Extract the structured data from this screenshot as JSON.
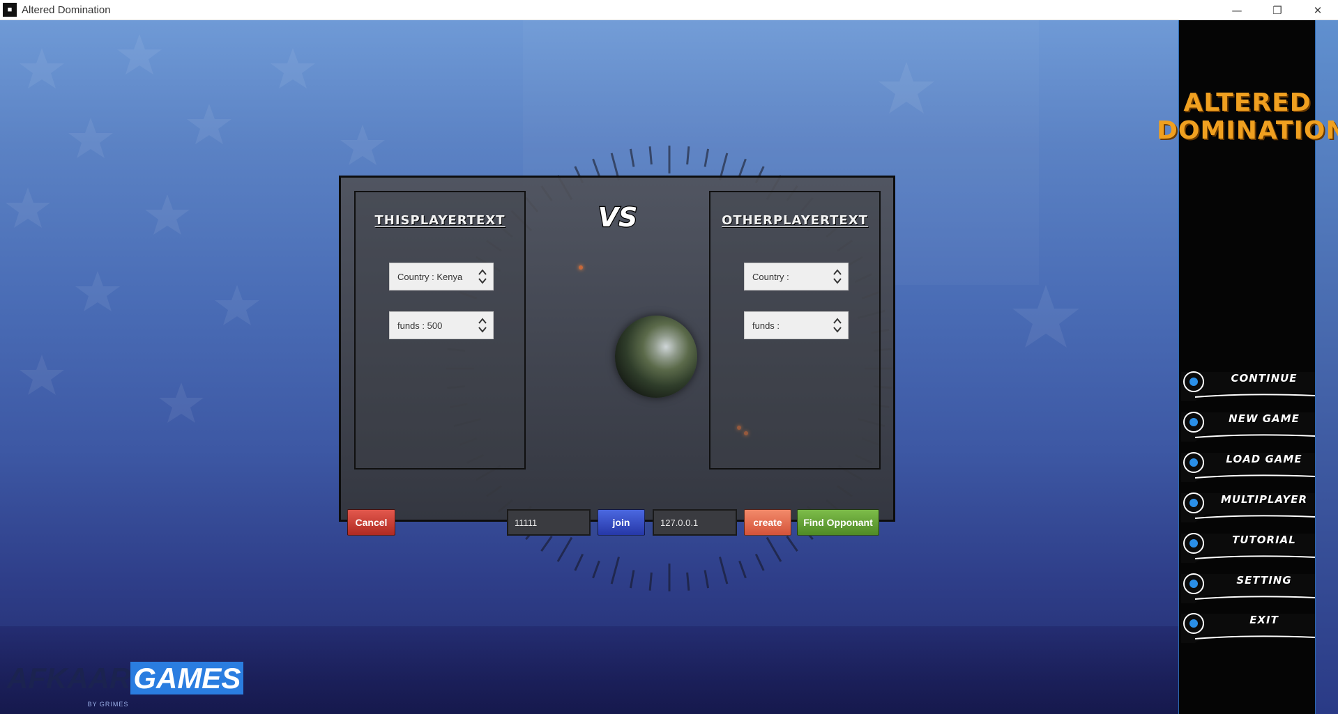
{
  "window": {
    "title": "Altered Domination",
    "icon": "app-icon",
    "controls": [
      "minimize-icon",
      "restore-icon",
      "close-icon"
    ]
  },
  "game_logo": {
    "line1": "ALTERED",
    "line2": "DOMINATION",
    "color": "#f0a020"
  },
  "dialog": {
    "this_player": {
      "title": "THISPLAYERTEXT",
      "country": "Country : Kenya",
      "funds": "funds : 500"
    },
    "vs_label": "VS",
    "other_player": {
      "title": "OTHERPLAYERTEXT",
      "country": "Country :",
      "funds": "funds :"
    },
    "cancel_label": "Cancel",
    "port_value": "11111",
    "join_label": "join",
    "ip_value": "127.0.0.1",
    "create_label": "create",
    "find_label": "Find Opponant"
  },
  "menu": {
    "items": [
      {
        "label": "CONTINUE"
      },
      {
        "label": "NEW GAME"
      },
      {
        "label": "LOAD GAME"
      },
      {
        "label": "MULTIPLAYER"
      },
      {
        "label": "TUTORIAL"
      },
      {
        "label": "SETTING"
      },
      {
        "label": "EXIT"
      }
    ],
    "accent": "#2a8fe8"
  },
  "company": {
    "name_part1": "AFKAAR",
    "name_part2": "GAMES",
    "byline": "BY GRIMES"
  },
  "colors": {
    "cancel": "#c8392f",
    "join": "#3249c4",
    "create": "#e56d52",
    "find": "#66a336"
  }
}
